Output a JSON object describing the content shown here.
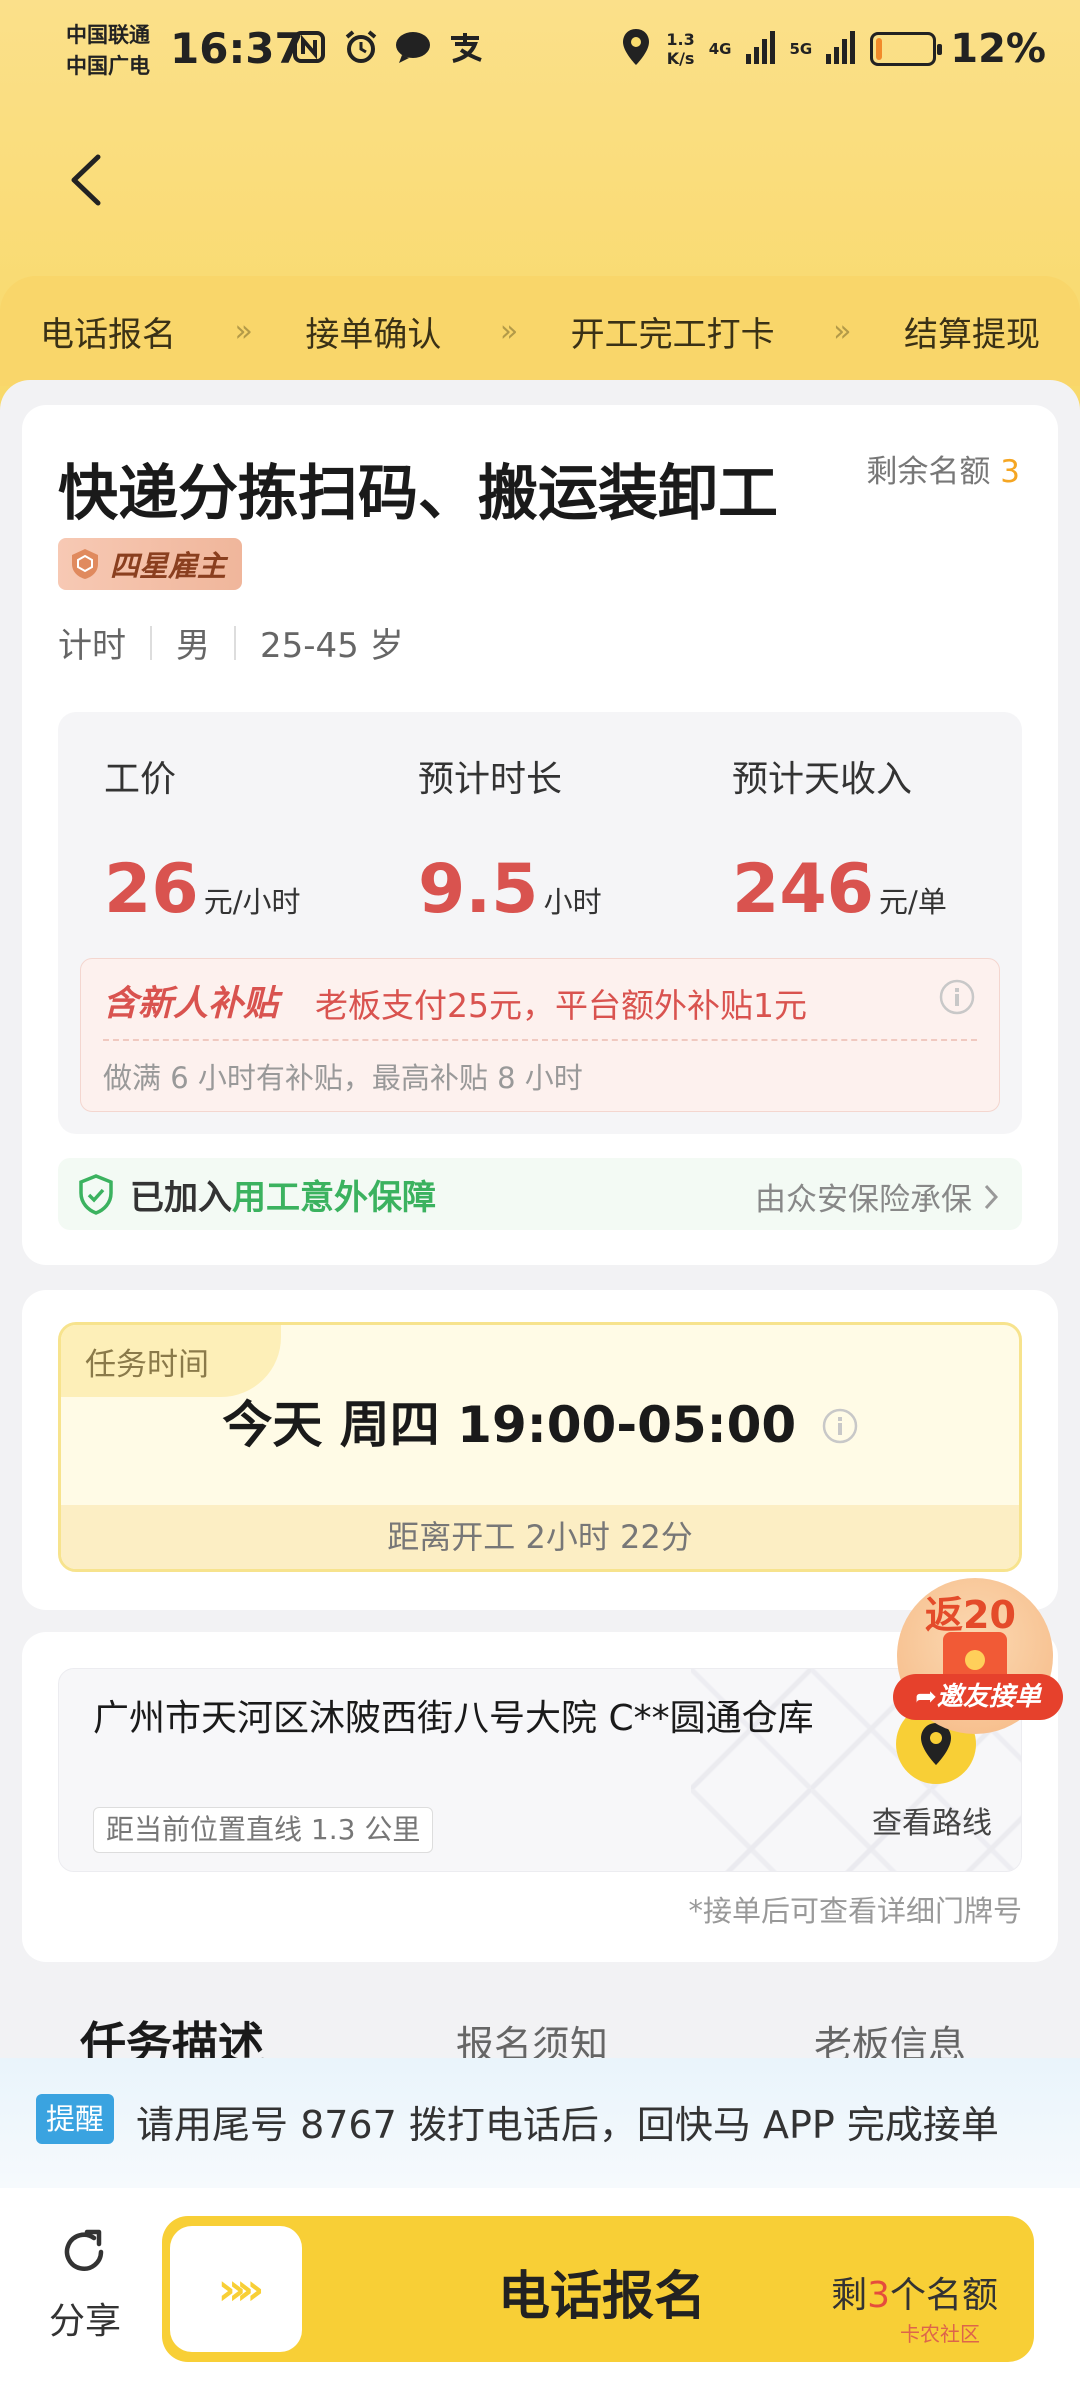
{
  "status_bar": {
    "carrier1": "中国联通",
    "carrier2": "中国广电",
    "time": "16:37",
    "net_speed_value": "1.3",
    "net_speed_unit": "K/s",
    "net1": "4G",
    "net2": "5G",
    "battery_pct": "12%",
    "battery_level": 0.12
  },
  "steps": [
    "电话报名",
    "接单确认",
    "开工完工打卡",
    "结算提现"
  ],
  "step_separator": "»",
  "job": {
    "title": "快递分拣扫码、搬运装卸工",
    "quota_label": "剩余名额",
    "quota_count": "3",
    "badge": "四星雇主",
    "tags": [
      "计时",
      "男",
      "25-45 岁"
    ]
  },
  "pay": {
    "items": [
      {
        "label": "工价",
        "value": "26",
        "unit": "元/小时"
      },
      {
        "label": "预计时长",
        "value": "9.5",
        "unit": "小时"
      },
      {
        "label": "预计天收入",
        "value": "246",
        "unit": "元/单"
      }
    ],
    "subsidy_tag": "含新人补贴",
    "subsidy_text": "老板支付25元，平台额外补贴1元",
    "subsidy_note": "做满 6 小时有补贴，最高补贴 8 小时"
  },
  "insurance": {
    "prefix": "已加入",
    "highlight": "用工意外保障",
    "provider": "由众安保险承保"
  },
  "task_time": {
    "tag": "任务时间",
    "main": "今天 周四 19:00-05:00",
    "countdown": "距离开工 2小时 22分"
  },
  "address": {
    "text": "广州市天河区沐陂西街八号大院 C**圆通仓库",
    "distance": "距当前位置直线 1.3 公里",
    "route_label": "查看路线",
    "note": "*接单后可查看详细门牌号"
  },
  "promo": {
    "amount": "返20",
    "button": "邀友接单"
  },
  "tabs": [
    "任务描述",
    "报名须知",
    "老板信息"
  ],
  "reminder": {
    "tag": "提醒",
    "text": "请用尾号 8767 拨打电话后，回快马 APP 完成接单"
  },
  "bottom": {
    "share": "分享",
    "cta_label": "电话报名",
    "cta_quota_prefix": "剩",
    "cta_quota_num": "3",
    "cta_quota_suffix": "个名额",
    "slider_arrows": "»»",
    "watermark": "卡农社区"
  },
  "colors": {
    "accent": "#f8cf36",
    "price": "#d9534f",
    "safe_green": "#3bb25f"
  }
}
